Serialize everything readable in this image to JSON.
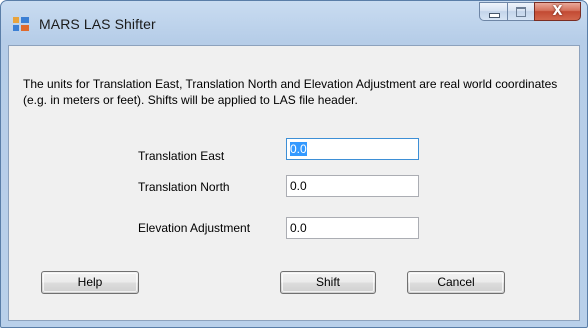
{
  "window": {
    "title": "MARS LAS Shifter",
    "icon": "app-icon",
    "caption_buttons": {
      "minimize": "minimize-icon",
      "maximize": "maximize-icon",
      "close_glyph": "X"
    }
  },
  "description": "The units for Translation East, Translation North and Elevation Adjustment are real world coordinates (e.g. in meters or feet). Shifts will be applied to LAS file header.",
  "fields": {
    "translation_east": {
      "label": "Translation East",
      "value": "0.0"
    },
    "translation_north": {
      "label": "Translation North",
      "value": "0.0"
    },
    "elevation_adjustment": {
      "label": "Elevation Adjustment",
      "value": "0.0"
    }
  },
  "buttons": {
    "help": "Help",
    "shift": "Shift",
    "cancel": "Cancel"
  },
  "colors": {
    "title_bar": "#b9d0ea",
    "close_button": "#c24a33",
    "focus_border": "#3d8fd6",
    "selection": "#3399ff"
  }
}
